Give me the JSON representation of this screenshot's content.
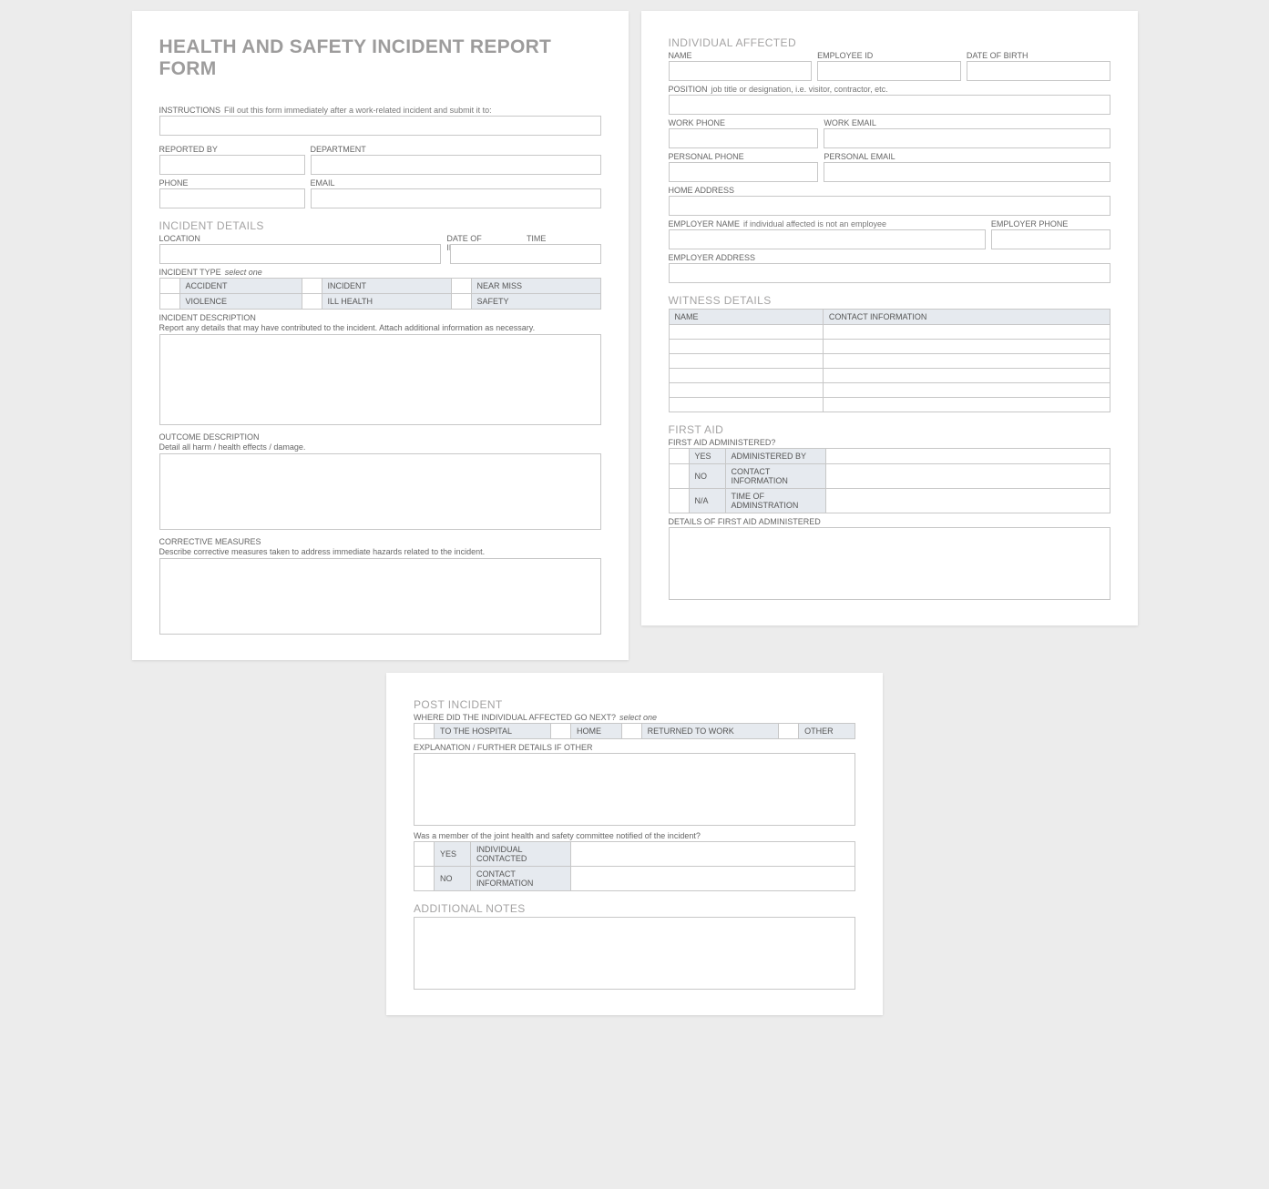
{
  "form": {
    "title": "HEALTH AND SAFETY INCIDENT REPORT FORM",
    "instructions_label": "INSTRUCTIONS",
    "instructions_text": "Fill out this form immediately after a work-related incident and submit it to:",
    "reported_by": "REPORTED BY",
    "department": "DEPARTMENT",
    "phone": "PHONE",
    "email": "EMAIL"
  },
  "incident": {
    "heading": "INCIDENT DETAILS",
    "location": "LOCATION",
    "date": "DATE OF INCIDENT",
    "time": "TIME",
    "type_label": "INCIDENT TYPE",
    "select_one": "select one",
    "types": [
      "ACCIDENT",
      "INCIDENT",
      "NEAR MISS",
      "VIOLENCE",
      "ILL HEALTH",
      "SAFETY"
    ],
    "desc_label": "INCIDENT DESCRIPTION",
    "desc_sub": "Report any details that may have contributed to the incident.  Attach additional information as necessary.",
    "outcome_label": "OUTCOME DESCRIPTION",
    "outcome_sub": "Detail all harm / health effects / damage.",
    "corrective_label": "CORRECTIVE MEASURES",
    "corrective_sub": "Describe corrective measures taken to address immediate hazards related to the incident."
  },
  "individual": {
    "heading": "INDIVIDUAL AFFECTED",
    "name": "NAME",
    "employee_id": "EMPLOYEE ID",
    "dob": "DATE OF BIRTH",
    "position_label": "POSITION",
    "position_sub": "job title or designation, i.e. visitor, contractor, etc.",
    "work_phone": "WORK PHONE",
    "work_email": "WORK EMAIL",
    "personal_phone": "PERSONAL PHONE",
    "personal_email": "PERSONAL EMAIL",
    "home_address": "HOME ADDRESS",
    "employer_name_label": "EMPLOYER NAME",
    "employer_name_sub": "if individual affected is not an employee",
    "employer_phone": "EMPLOYER PHONE",
    "employer_address": "EMPLOYER ADDRESS"
  },
  "witness": {
    "heading": "WITNESS DETAILS",
    "col_name": "NAME",
    "col_contact": "CONTACT INFORMATION"
  },
  "firstaid": {
    "heading": "FIRST AID",
    "administered_q": "FIRST AID ADMINISTERED?",
    "yes": "YES",
    "no": "NO",
    "na": "N/A",
    "admin_by": "ADMINISTERED BY",
    "contact": "CONTACT INFORMATION",
    "time": "TIME OF ADMINSTRATION",
    "details_label": "DETAILS OF FIRST AID ADMINISTERED"
  },
  "post": {
    "heading": "POST INCIDENT",
    "where_label": "WHERE DID THE INDIVIDUAL AFFECTED GO NEXT?",
    "select_one": "select one",
    "opts": [
      "TO THE HOSPITAL",
      "HOME",
      "RETURNED TO WORK",
      "OTHER"
    ],
    "explain_label": "EXPLANATION / FURTHER DETAILS IF OTHER",
    "committee_q": "Was a member of the joint health and safety committee notified of the incident?",
    "yes": "YES",
    "no": "NO",
    "individual_contacted": "INDIVIDUAL CONTACTED",
    "contact_info": "CONTACT INFORMATION"
  },
  "notes": {
    "heading": "ADDITIONAL NOTES"
  }
}
